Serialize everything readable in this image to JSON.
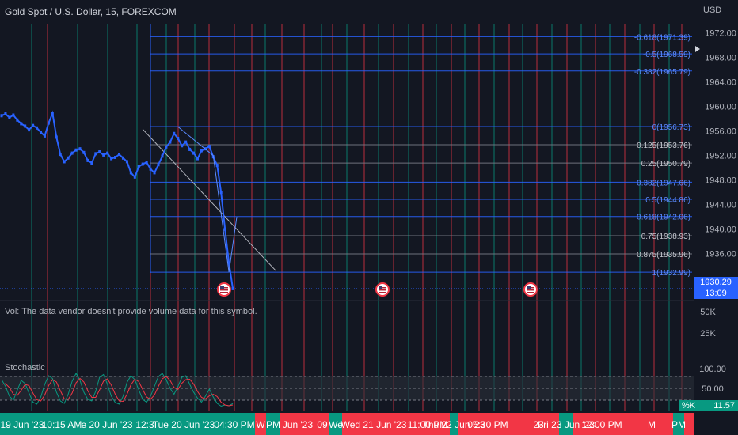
{
  "header": {
    "symbol_title": "Gold Spot / U.S. Dollar, 15, FOREXCOM",
    "currency": "USD"
  },
  "price_tag": {
    "price": "1930.29",
    "countdown": "13:09"
  },
  "volume_note": "Vol: The data vendor doesn't provide volume data for this symbol.",
  "stochastic": {
    "label": "Stochastic",
    "k_label": "%K",
    "k_value": "11.57"
  },
  "colors": {
    "background": "#131722",
    "candle": "#2962ff",
    "fib_blue": "#2962ff",
    "fib_gray": "#787b86",
    "red_line": "#f23645",
    "green_line": "#089981",
    "stoch_k": "#089981",
    "stoch_d": "#f23645"
  },
  "icons": {
    "event_marker": "us-flag-icon"
  },
  "chart_data": {
    "type": "line",
    "price_axis": {
      "ticks": [
        1972,
        1968,
        1964,
        1960,
        1956,
        1952,
        1948,
        1944,
        1940,
        1936,
        1932
      ],
      "labels": [
        "1972.00",
        "1968.00",
        "1964.00",
        "1960.00",
        "1956.00",
        "1952.00",
        "1948.00",
        "1944.00",
        "1940.00",
        "1936.00"
      ],
      "ylim": [
        1929,
        1973.5
      ]
    },
    "volume_axis": {
      "labels": [
        "50K",
        "25K"
      ]
    },
    "stoch_axis": {
      "labels": [
        "100.00",
        "50.00"
      ],
      "ylim": [
        0,
        100
      ]
    },
    "fib_levels": [
      {
        "label": "-0.618(1971.39)",
        "value": 1971.39,
        "style": "blue"
      },
      {
        "label": "-0.5(1968.59)",
        "value": 1968.59,
        "style": "blue"
      },
      {
        "label": "-0.382(1965.79)",
        "value": 1965.79,
        "style": "blue"
      },
      {
        "label": "0(1956.73)",
        "value": 1956.73,
        "style": "blue"
      },
      {
        "label": "0.125(1953.76)",
        "value": 1953.76,
        "style": "gray"
      },
      {
        "label": "0.25(1950.79)",
        "value": 1950.79,
        "style": "gray"
      },
      {
        "label": "0.382(1947.66)",
        "value": 1947.66,
        "style": "blue"
      },
      {
        "label": "0.5(1944.86)",
        "value": 1944.86,
        "style": "blue"
      },
      {
        "label": "0.618(1942.06)",
        "value": 1942.06,
        "style": "blue"
      },
      {
        "label": "0.75(1938.93)",
        "value": 1938.93,
        "style": "gray"
      },
      {
        "label": "0.875(1935.96)",
        "value": 1935.96,
        "style": "gray"
      },
      {
        "label": "1(1932.99)",
        "value": 1932.99,
        "style": "blue"
      }
    ],
    "series": [
      {
        "x": [
          0,
          1,
          2,
          3,
          4,
          5,
          6,
          7,
          8,
          9,
          10,
          11,
          12,
          13,
          14,
          15,
          16,
          17,
          18,
          19,
          20,
          21,
          22,
          23,
          24,
          25,
          26,
          27,
          28,
          29,
          30,
          31,
          32,
          33,
          34,
          35,
          36,
          37,
          38,
          39,
          40,
          41,
          42,
          43,
          44,
          45,
          46,
          47,
          48,
          49,
          50,
          51,
          52,
          53,
          54,
          55,
          56,
          57,
          58,
          59
        ],
        "values": [
          1958.5,
          1958.8,
          1958.2,
          1958.6,
          1957.8,
          1957.2,
          1956.8,
          1956.2,
          1956.9,
          1956.5,
          1955.8,
          1955.2,
          1957.3,
          1958.9,
          1955.0,
          1952.2,
          1951.0,
          1951.6,
          1952.4,
          1952.9,
          1953.1,
          1952.5,
          1951.2,
          1950.8,
          1952.3,
          1952.6,
          1952.1,
          1952.4,
          1951.5,
          1951.7,
          1952.2,
          1951.6,
          1951.0,
          1949.2,
          1948.5,
          1950.2,
          1950.6,
          1950.9,
          1949.8,
          1949.2,
          1950.5,
          1951.9,
          1953.4,
          1954.2,
          1955.6,
          1954.8,
          1953.6,
          1954.2,
          1953.0,
          1952.4,
          1951.5,
          1952.8,
          1953.1,
          1953.5,
          1951.8,
          1950.4,
          1946.0,
          1940.0,
          1934.5,
          1930.3
        ]
      }
    ],
    "zigzag": [
      [
        45,
        1956.7
      ],
      [
        54,
        1952.0
      ],
      [
        58,
        1933.0
      ],
      [
        60,
        1942.0
      ]
    ],
    "trend_line": [
      [
        36,
        1956.3
      ],
      [
        70,
        1933.2
      ]
    ],
    "stoch_series": [
      {
        "name": "%K",
        "values": [
          72,
          55,
          30,
          20,
          45,
          70,
          62,
          38,
          15,
          10,
          28,
          60,
          82,
          75,
          40,
          18,
          12,
          35,
          68,
          88,
          70,
          40,
          22,
          18,
          42,
          78,
          85,
          60,
          30,
          14,
          10,
          30,
          65,
          82,
          72,
          46,
          22,
          15,
          30,
          55,
          80,
          88,
          72,
          50,
          35,
          55,
          78,
          82,
          60,
          40,
          25,
          15,
          30,
          48,
          28,
          12,
          5,
          8,
          6,
          11.57
        ]
      },
      {
        "name": "%D",
        "values": [
          60,
          62,
          52,
          35,
          32,
          45,
          60,
          57,
          38,
          21,
          18,
          33,
          57,
          72,
          66,
          44,
          23,
          22,
          38,
          64,
          75,
          66,
          44,
          27,
          27,
          46,
          68,
          74,
          58,
          35,
          18,
          17,
          35,
          59,
          73,
          67,
          47,
          28,
          22,
          33,
          55,
          74,
          80,
          70,
          52,
          47,
          63,
          72,
          73,
          61,
          42,
          27,
          23,
          31,
          35,
          29,
          15,
          8,
          6,
          8
        ]
      }
    ],
    "time_labels": [
      "19 Jun '23",
      "10:15 AM",
      "e 20 Jun '23",
      "12:3",
      "Tue 20 Jun '23",
      "04:30 PM",
      "W",
      "PM",
      "Jun '23",
      "09",
      "We",
      "Wed 21 Jun '23",
      "11:00 PM",
      "Thu 22 Jun '23",
      "05:30 PM",
      "23",
      "Fri 23 Jun '23",
      "12:00 PM",
      "M",
      "PM"
    ]
  }
}
